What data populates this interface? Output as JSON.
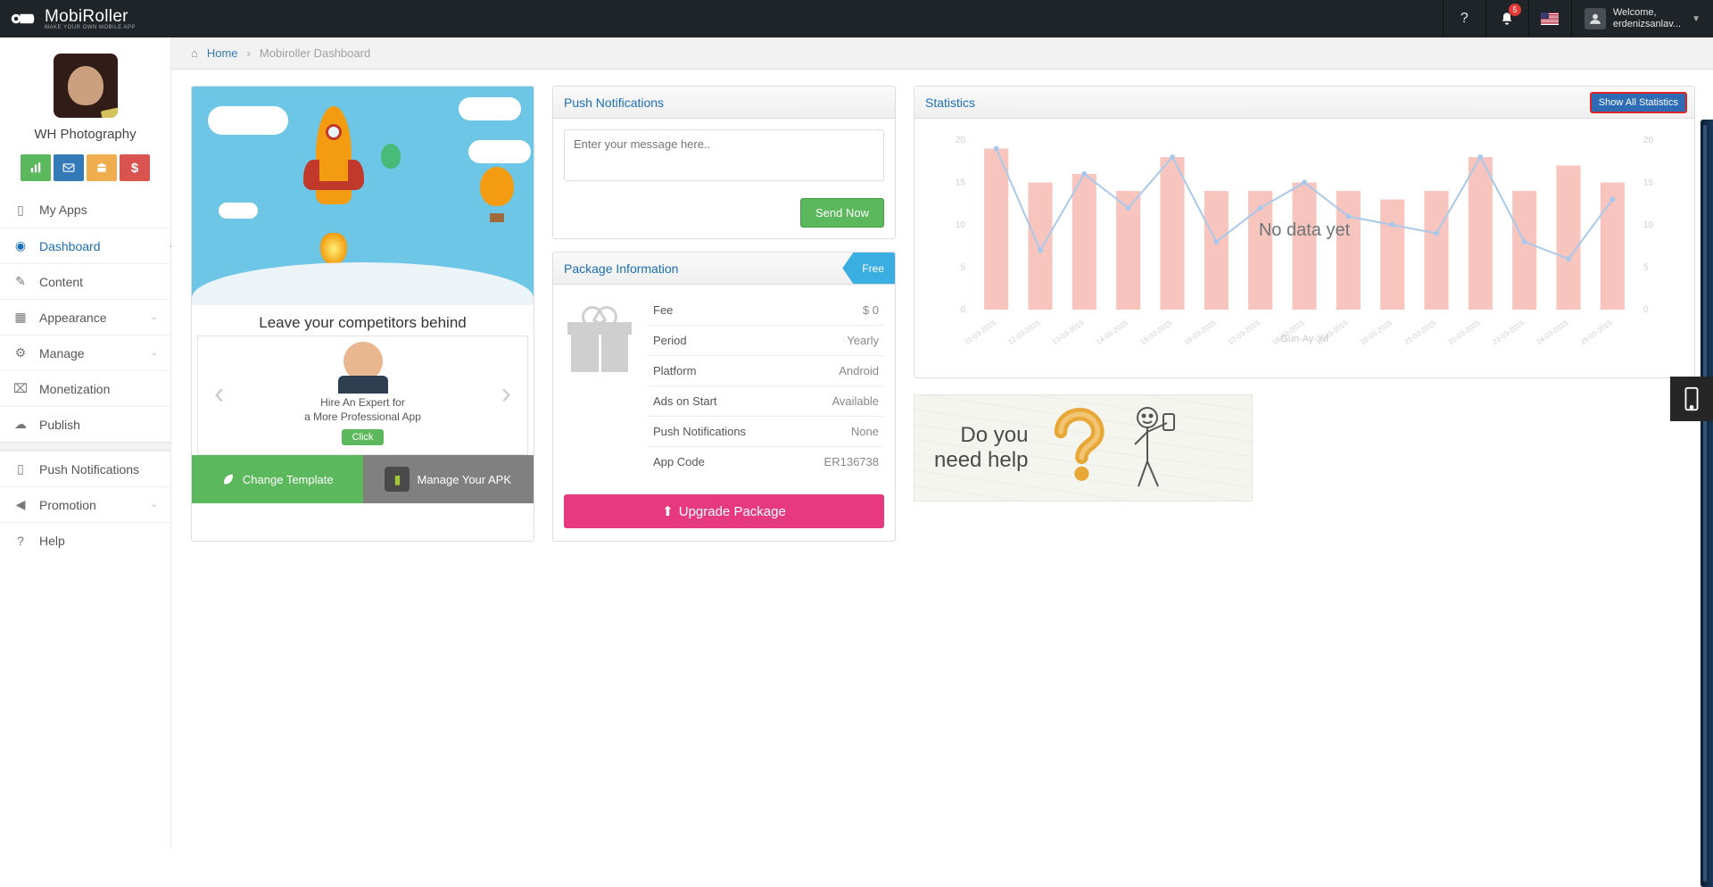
{
  "brand": {
    "name": "MobiRoller",
    "tagline": "MAKE YOUR OWN MOBILE APP"
  },
  "topbar": {
    "notification_count": "5",
    "welcome_label": "Welcome,",
    "username": "erdenizsanlav..."
  },
  "breadcrumb": {
    "home": "Home",
    "current": "Mobiroller Dashboard"
  },
  "app": {
    "name": "WH Photography"
  },
  "sidebar": {
    "items": [
      {
        "label": "My Apps"
      },
      {
        "label": "Dashboard"
      },
      {
        "label": "Content"
      },
      {
        "label": "Appearance"
      },
      {
        "label": "Manage"
      },
      {
        "label": "Monetization"
      },
      {
        "label": "Publish"
      },
      {
        "label": "Push Notifications"
      },
      {
        "label": "Promotion"
      },
      {
        "label": "Help"
      }
    ]
  },
  "promo": {
    "headline": "Leave your competitors behind",
    "carousel": {
      "line1": "Hire An Expert for",
      "line2": "a More Professional App",
      "cta": "Click"
    },
    "change_template": "Change Template",
    "manage_apk": "Manage Your APK"
  },
  "push": {
    "title": "Push Notifications",
    "placeholder": "Enter your message here..",
    "send": "Send Now"
  },
  "package": {
    "title": "Package Information",
    "ribbon": "Free",
    "rows": [
      {
        "k": "Fee",
        "v": "$ 0"
      },
      {
        "k": "Period",
        "v": "Yearly"
      },
      {
        "k": "Platform",
        "v": "Android"
      },
      {
        "k": "Ads on Start",
        "v": "Available"
      },
      {
        "k": "Push Notifications",
        "v": "None"
      },
      {
        "k": "App Code",
        "v": "ER136738"
      }
    ],
    "upgrade": "Upgrade Package"
  },
  "stats": {
    "title": "Statistics",
    "show_all": "Show All Statistics",
    "no_data": "No data yet",
    "axis_label": "Gün-Ay-Yıl"
  },
  "help": {
    "line1": "Do you",
    "line2": "need help"
  },
  "chart_data": {
    "type": "bar+line",
    "categories": [
      "11-03-2015",
      "12-03-2015",
      "13-03-2015",
      "14-03-2015",
      "15-03-2015",
      "16-03-2015",
      "17-03-2015",
      "18-03-2015",
      "19-03-2015",
      "20-03-2015",
      "21-03-2015",
      "22-03-2015",
      "23-03-2015",
      "24-03-2015",
      "25-03-2015"
    ],
    "y_ticks": [
      0,
      5,
      10,
      15,
      20
    ],
    "ylim": [
      0,
      20
    ],
    "series": [
      {
        "name": "bars",
        "type": "bar",
        "values": [
          19,
          15,
          16,
          14,
          18,
          14,
          14,
          15,
          14,
          13,
          14,
          18,
          14,
          17,
          15
        ]
      },
      {
        "name": "line",
        "type": "line",
        "values": [
          19,
          7,
          16,
          12,
          18,
          8,
          12,
          15,
          11,
          10,
          9,
          18,
          8,
          6,
          13
        ]
      }
    ],
    "xlabel": "Gün-Ay-Yıl"
  }
}
